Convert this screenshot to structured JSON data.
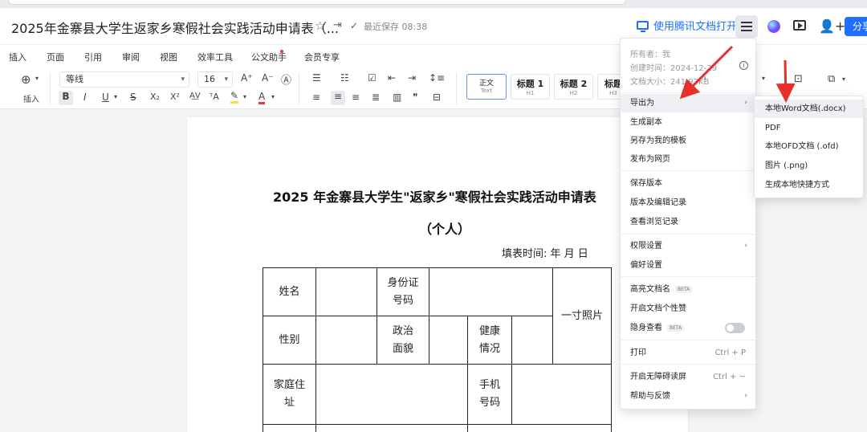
{
  "app": {
    "doc_title": "2025年金寨县大学生返家乡寒假社会实践活动申请表（...",
    "save_status": "最近保存 08:38",
    "open_in_app": "使用腾讯文档打开",
    "share_label": "分享",
    "accent_color": "#1e6fff"
  },
  "menubar": {
    "tabs": [
      "插入",
      "页面",
      "引用",
      "审阅",
      "视图",
      "效率工具",
      "公文助手",
      "会员专享"
    ]
  },
  "toolbar": {
    "insert_label": "插入",
    "font_name": "等线",
    "font_size": "16",
    "styles": [
      {
        "title": "正文",
        "sub": "Text"
      },
      {
        "title": "标题 1",
        "sub": "H1"
      },
      {
        "title": "标题 2",
        "sub": "H2"
      },
      {
        "title": "标题",
        "sub": "H3"
      }
    ]
  },
  "document": {
    "title": "2025 年金寨县大学生\"返家乡\"寒假社会实践活动申请表",
    "subtitle": "（个人）",
    "fill_time": "填表时间:    年   月   日",
    "table": {
      "name": "姓名",
      "id_number": "身份证\n号码",
      "photo": "一寸照片",
      "gender": "性别",
      "political": "政治\n面貌",
      "health": "健康\n情况",
      "address": "家庭住\n址",
      "phone": "手机\n号码"
    }
  },
  "menu": {
    "owner": "所有者：我",
    "created": "创建时间：2024-12-29",
    "size": "文档大小：241.92KB",
    "items": [
      {
        "label": "导出为",
        "arrow": "›"
      },
      {
        "label": "生成副本"
      },
      {
        "label": "另存为我的模板"
      },
      {
        "label": "发布为网页"
      },
      {
        "label": "保存版本"
      },
      {
        "label": "版本及编辑记录"
      },
      {
        "label": "查看浏览记录"
      },
      {
        "label": "权限设置",
        "arrow": "›"
      },
      {
        "label": "偏好设置"
      },
      {
        "label": "高亮文档名",
        "badge": "BETA"
      },
      {
        "label": "开启文档个性赞"
      },
      {
        "label": "隐身查看",
        "badge": "BETA"
      },
      {
        "label": "打印",
        "shortcut": "Ctrl + P"
      },
      {
        "label": "开启无障碍读屏",
        "shortcut": "Ctrl + ~"
      },
      {
        "label": "帮助与反馈",
        "arrow": "›"
      }
    ]
  },
  "submenu": {
    "items": [
      "本地Word文档(.docx)",
      "PDF",
      "本地OFD文档 (.ofd)",
      "图片 (.png)",
      "生成本地快捷方式"
    ]
  },
  "annotation_color": "#e8302a"
}
